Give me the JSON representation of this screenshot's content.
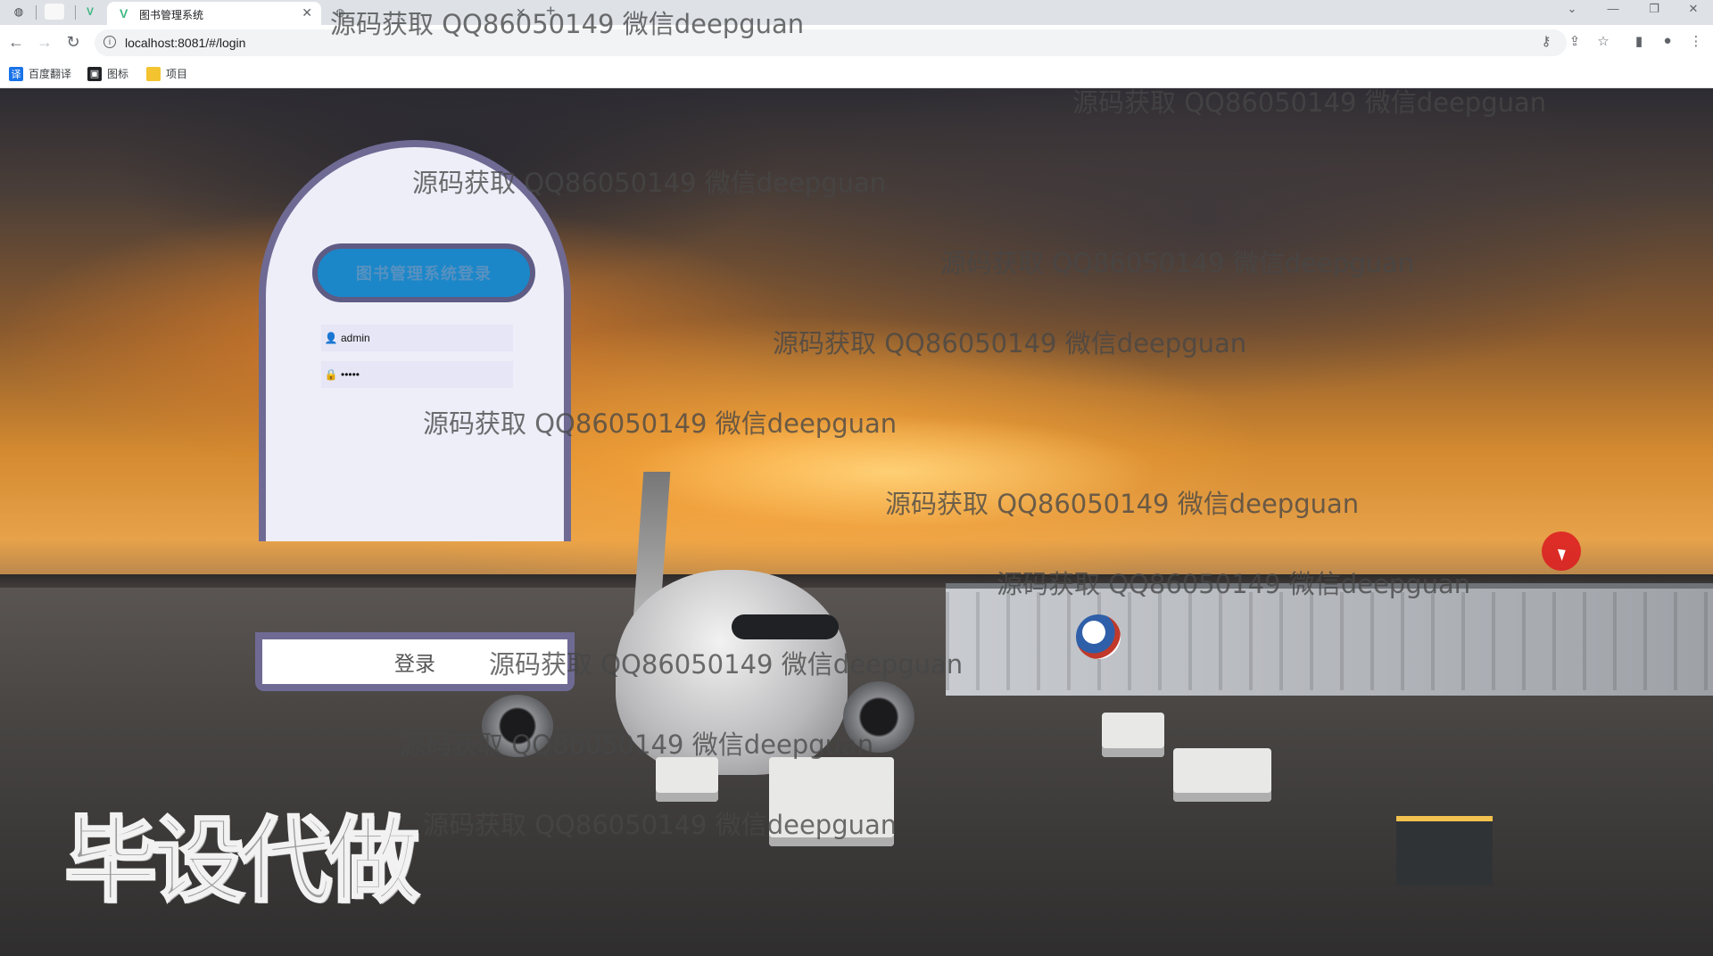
{
  "browser": {
    "tabs": [
      {
        "title": "图书管理系统",
        "active": true
      },
      {
        "title": "",
        "active": false
      }
    ],
    "address_bar": {
      "url": "localhost:8081/#/login"
    },
    "bookmarks": [
      {
        "label": "百度翻译",
        "icon": "translate-icon",
        "color": "#1a73e8"
      },
      {
        "label": "图标",
        "icon": "picture-icon",
        "color": "#202124"
      },
      {
        "label": "项目",
        "icon": "folder-icon",
        "color": "#f4c430"
      }
    ]
  },
  "login": {
    "title": "图书管理系统登录",
    "username": "admin",
    "password": "•••••",
    "submit_label": "登录"
  },
  "overlay": {
    "watermark_text": "源码获取 QQ86050149 微信deepguan",
    "stamp_text": "毕设代做"
  },
  "colors": {
    "card_border": "#6f6a94",
    "card_bg": "#eeeef8",
    "title_bg": "#1b87c9",
    "cursor_highlight": "#dc141e"
  }
}
